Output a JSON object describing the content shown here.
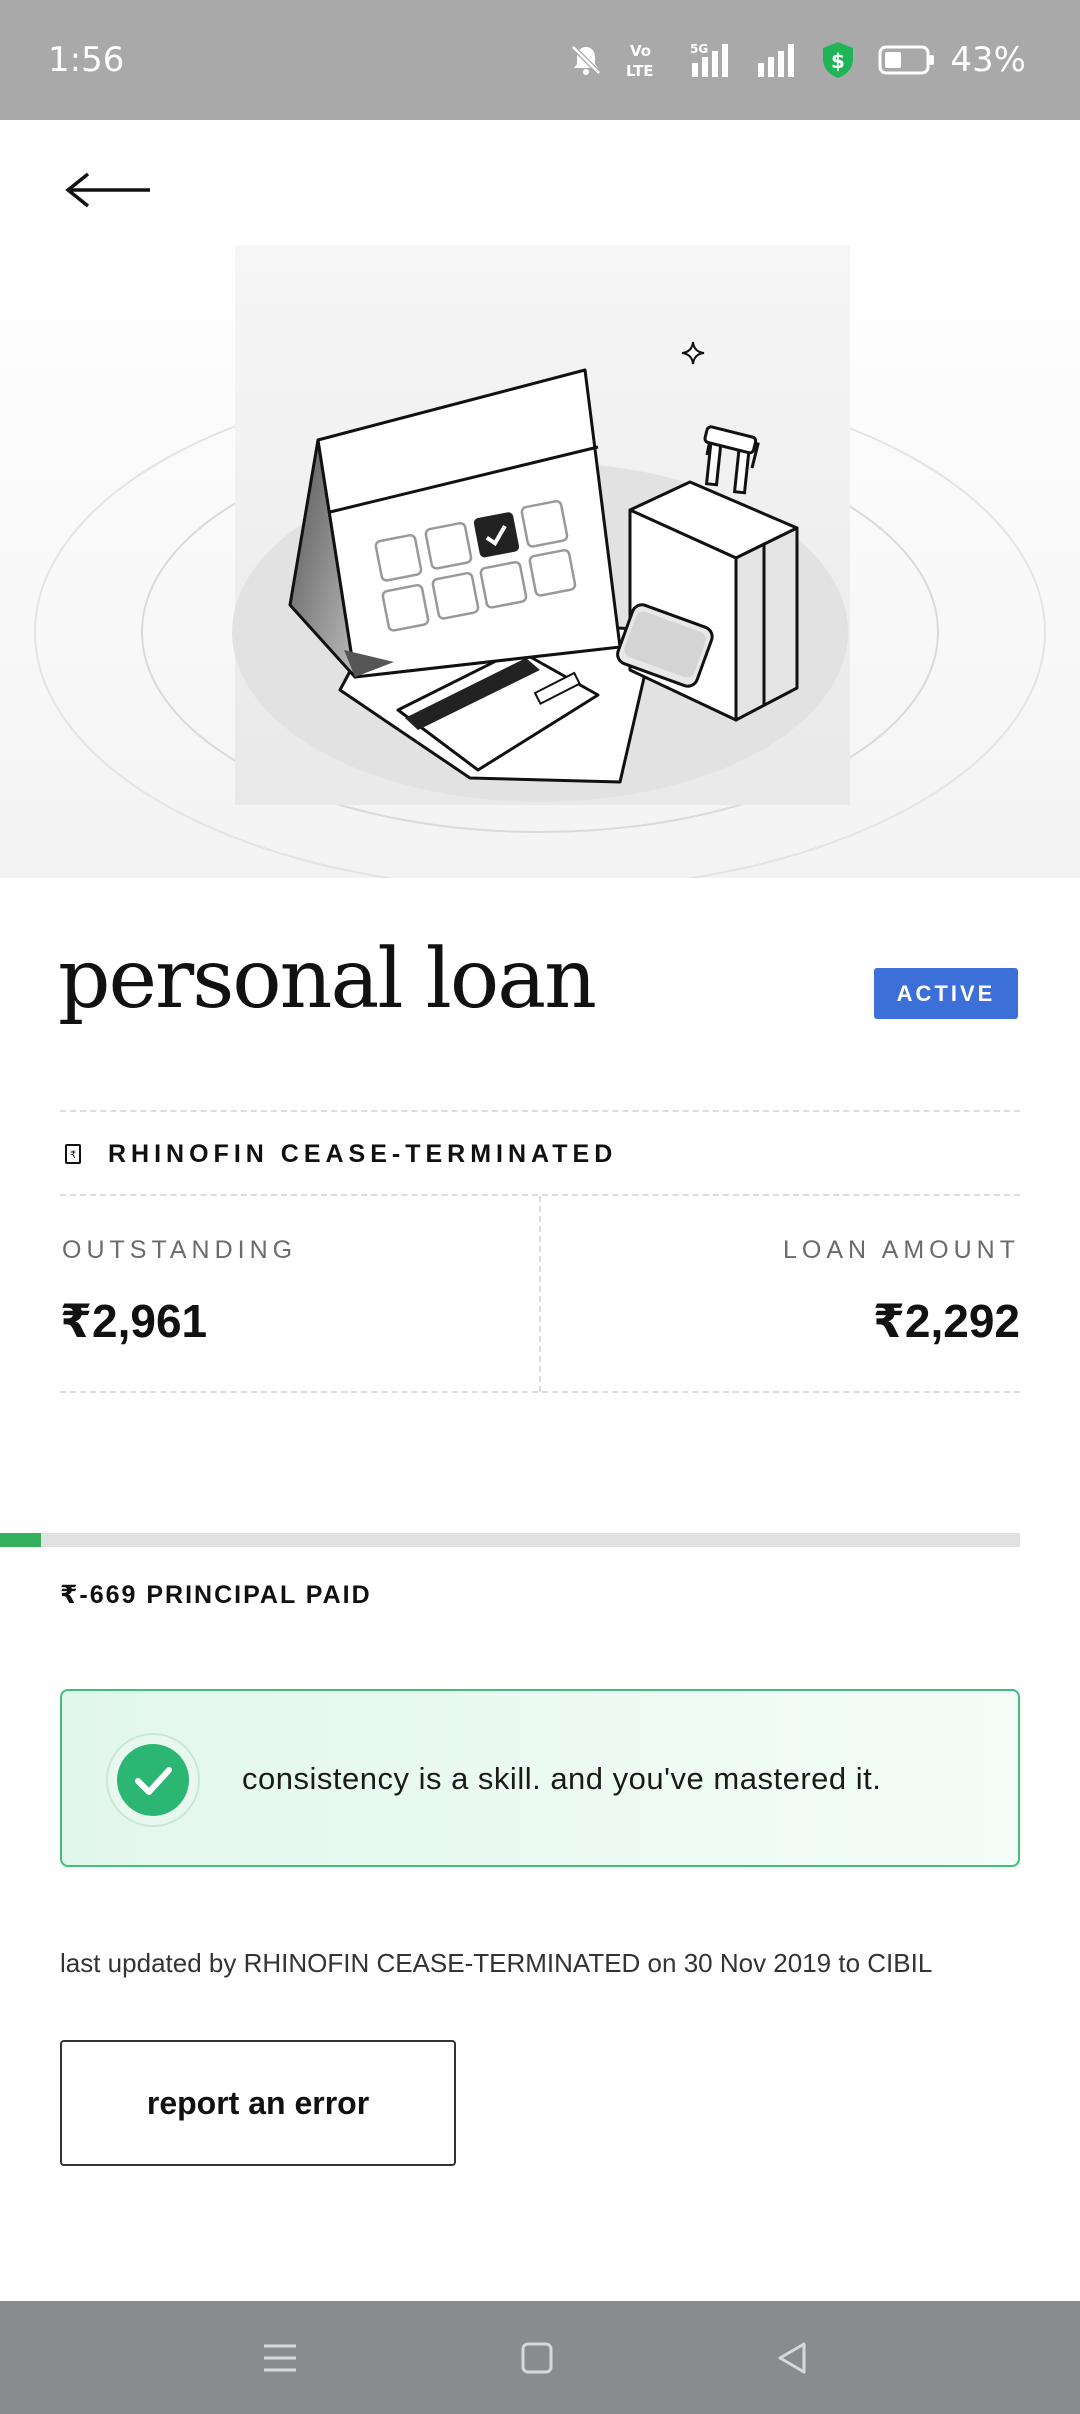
{
  "status_bar": {
    "time": "1:56",
    "icons": [
      "mute-icon",
      "volte-icon",
      "signal-5g-icon",
      "signal-icon",
      "security-shield-icon",
      "battery-icon"
    ],
    "network_labels": [
      "Vo",
      "LTE",
      "5G"
    ],
    "battery_percent": "43%"
  },
  "header": {
    "back_icon": "back-arrow-icon"
  },
  "loan": {
    "title": "personal loan",
    "status": "ACTIVE",
    "lender": "RHINOFIN CEASE-TERMINATED",
    "outstanding_label": "OUTSTANDING",
    "outstanding_value": "₹2,961",
    "loan_amount_label": "LOAN AMOUNT",
    "loan_amount_value": "₹2,292",
    "principal_paid_text": "₹-669 PRINCIPAL PAID",
    "progress_fraction": 0.04
  },
  "banner": {
    "icon": "check-circle-icon",
    "message": "consistency is a skill. and you've mastered it."
  },
  "footer": {
    "updated_text": "last updated by RHINOFIN CEASE-TERMINATED on 30 Nov 2019 to CIBIL",
    "report_button": "report an error"
  },
  "nav_bar": {
    "buttons": [
      "menu-icon",
      "home-icon",
      "back-icon"
    ]
  },
  "colors": {
    "status_bar_bg": "#a9a9a9",
    "badge_blue": "#3d6fd8",
    "progress_green": "#34b05a",
    "banner_border": "#3fbf7a",
    "nav_bar_bg": "#8a8b8f"
  }
}
